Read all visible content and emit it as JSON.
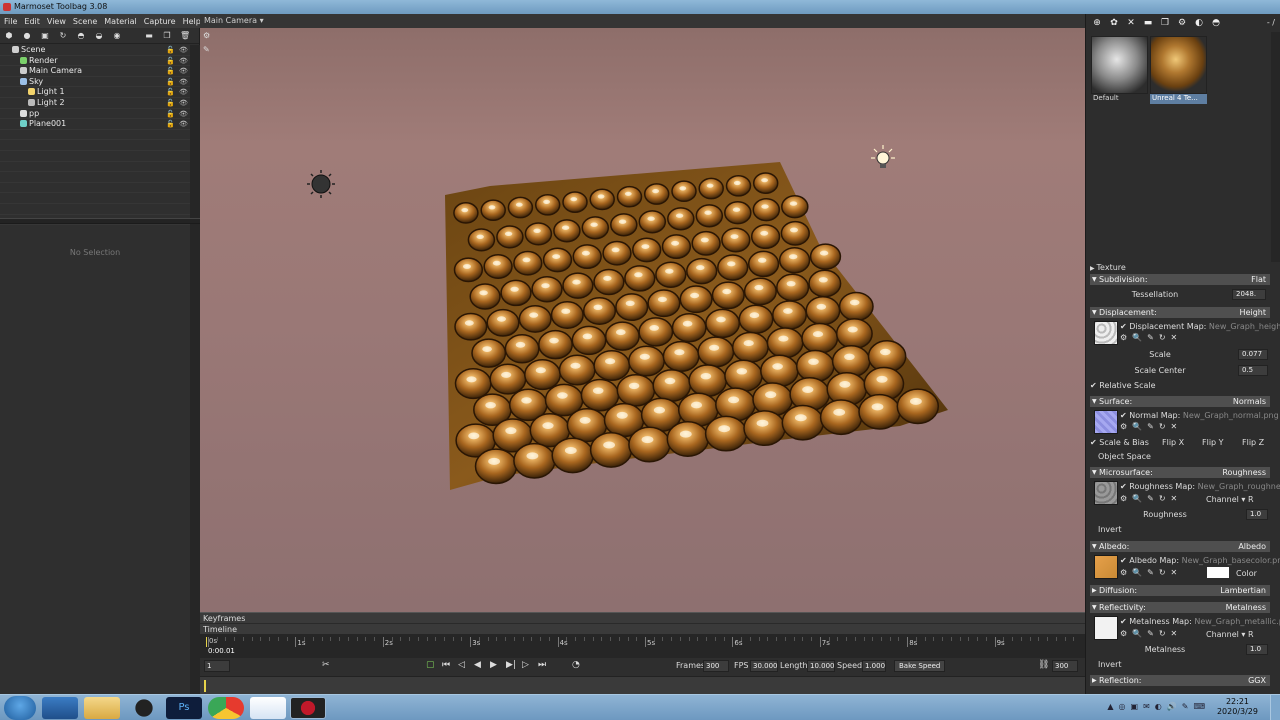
{
  "app": {
    "title": "Marmoset Toolbag 3.08"
  },
  "menu": [
    "File",
    "Edit",
    "View",
    "Scene",
    "Material",
    "Capture",
    "Help"
  ],
  "scene_tree": [
    {
      "label": "Scene",
      "icon": "scene-icon",
      "indent": 0,
      "color": "#cfcfcf"
    },
    {
      "label": "Render",
      "icon": "render-icon",
      "indent": 1,
      "color": "#7bd06a"
    },
    {
      "label": "Main Camera",
      "icon": "camera-icon",
      "indent": 1,
      "color": "#cccccc"
    },
    {
      "label": "Sky",
      "icon": "sky-icon",
      "indent": 1,
      "color": "#9bbfe6"
    },
    {
      "label": "Light 1",
      "icon": "bulb-icon",
      "indent": 2,
      "color": "#f2d36b"
    },
    {
      "label": "Light 2",
      "icon": "bulb-icon",
      "indent": 2,
      "color": "#bbbbbb"
    },
    {
      "label": "pp",
      "icon": "postprocess-icon",
      "indent": 1,
      "color": "#dddddd"
    },
    {
      "label": "Plane001",
      "icon": "mesh-icon",
      "indent": 1,
      "color": "#6fd0c8"
    }
  ],
  "left_panel": {
    "no_selection": "No Selection"
  },
  "viewport": {
    "camera_label": "Main Camera ▾"
  },
  "timeline": {
    "keyframes_label": "Keyframes",
    "timeline_label": "Timeline",
    "current_time": "0:00.01",
    "ticks": [
      "0s",
      "1s",
      "2s",
      "3s",
      "4s",
      "5s",
      "6s",
      "7s",
      "8s",
      "9s"
    ],
    "frame_value": "1",
    "frames_label": "Frames",
    "frames_value": "300",
    "fps_label": "FPS",
    "fps_value": "30.000",
    "length_label": "Length",
    "length_value": "10.000",
    "speed_label": "Speed",
    "speed_value": "1.000",
    "bake_speed_label": "Bake Speed",
    "end_frames_value": "300"
  },
  "materials": {
    "version_label": "- /",
    "items": [
      {
        "label": "Default",
        "selected": false
      },
      {
        "label": "Unreal 4 Te...",
        "selected": true
      }
    ]
  },
  "properties": {
    "texture": "Texture",
    "subdivision": {
      "label": "Subdivision:",
      "value": "Flat"
    },
    "tessellation": {
      "label": "Tessellation",
      "value": "2048."
    },
    "displacement": {
      "label": "Displacement:",
      "value": "Height"
    },
    "displacement_map": {
      "label": "Displacement Map:",
      "file": "New_Graph_height.p"
    },
    "scale": {
      "label": "Scale",
      "value": "0.077"
    },
    "scale_center": {
      "label": "Scale Center",
      "value": "0.5"
    },
    "relative_scale": "Relative Scale",
    "surface": {
      "label": "Surface:",
      "value": "Normals"
    },
    "normal_map": {
      "label": "Normal Map:",
      "file": "New_Graph_normal.png"
    },
    "scale_bias": "Scale & Bias",
    "flip_x": "Flip X",
    "flip_y": "Flip Y",
    "flip_z": "Flip Z",
    "object_space": "Object Space",
    "microsurface": {
      "label": "Microsurface:",
      "value": "Roughness"
    },
    "roughness_map": {
      "label": "Roughness Map:",
      "file": "New_Graph_roughnes"
    },
    "channel_r1": "Channel ▾ R",
    "roughness": {
      "label": "Roughness",
      "value": "1.0"
    },
    "invert1": "Invert",
    "albedo": {
      "label": "Albedo:",
      "value": "Albedo"
    },
    "albedo_map": {
      "label": "Albedo Map:",
      "file": "New_Graph_basecolor.png"
    },
    "color": "Color",
    "diffusion": {
      "label": "Diffusion:",
      "value": "Lambertian"
    },
    "reflectivity": {
      "label": "Reflectivity:",
      "value": "Metalness"
    },
    "metalness_map": {
      "label": "Metalness Map:",
      "file": "New_Graph_metallic.pn"
    },
    "channel_r2": "Channel ▾ R",
    "metalness": {
      "label": "Metalness",
      "value": "1.0"
    },
    "invert2": "Invert",
    "reflection": {
      "label": "Reflection:",
      "value": "GGX"
    }
  },
  "taskbar": {
    "time": "22:21",
    "date": "2020/3/29",
    "apps": [
      "explorer",
      "folder",
      "qq",
      "photoshop",
      "chrome",
      "feishu",
      "marmoset"
    ]
  },
  "colors": {
    "viewport_bg": "#9a7876",
    "panel_bg": "#2d2d2d",
    "header_bg": "#4f4f4f",
    "selection": "#5e7ea1",
    "gold": "#c98a35"
  }
}
